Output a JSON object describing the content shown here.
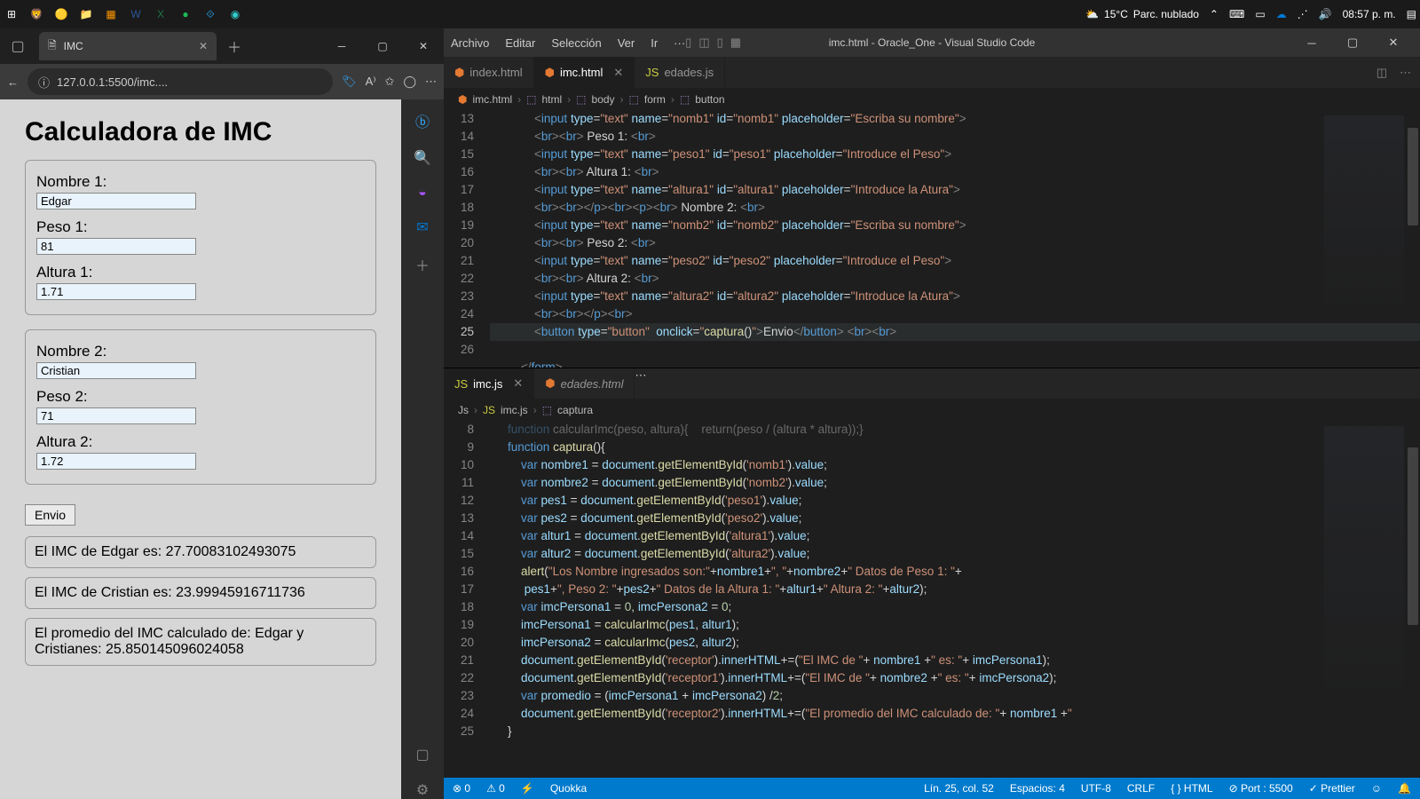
{
  "os_taskbar": {
    "weather_temp": "15°C",
    "weather_desc": "Parc. nublado",
    "time": "08:57 p. m."
  },
  "browser": {
    "tab_title": "IMC",
    "url": "127.0.0.1:5500/imc....",
    "page_title": "Calculadora de IMC",
    "labels": {
      "nombre1": "Nombre 1:",
      "peso1": "Peso 1:",
      "altura1": "Altura 1:",
      "nombre2": "Nombre 2:",
      "peso2": "Peso 2:",
      "altura2": "Altura 2:"
    },
    "values": {
      "nombre1": "Edgar",
      "peso1": "81",
      "altura1": "1.71",
      "nombre2": "Cristian",
      "peso2": "71",
      "altura2": "1.72"
    },
    "envio": "Envio",
    "result1": "El IMC de Edgar es: 27.70083102493075",
    "result2": "El IMC de Cristian es: 23.99945916711736",
    "result3": "El promedio del IMC calculado de: Edgar y Cristianes: 25.850145096024058"
  },
  "vscode": {
    "menu": [
      "Archivo",
      "Editar",
      "Selección",
      "Ver",
      "Ir",
      "···"
    ],
    "title": "imc.html - Oracle_One - Visual Studio Code",
    "tabs_top": [
      {
        "label": "index.html",
        "active": false,
        "type": "html"
      },
      {
        "label": "imc.html",
        "active": true,
        "type": "html",
        "closable": true
      },
      {
        "label": "edades.js",
        "active": false,
        "type": "js"
      }
    ],
    "breadcrumb_top": [
      "imc.html",
      "html",
      "body",
      "form",
      "button"
    ],
    "tabs_bottom": [
      {
        "label": "imc.js",
        "active": true,
        "type": "js",
        "closable": true
      },
      {
        "label": "edades.html",
        "active": false,
        "type": "html",
        "italic": true
      }
    ],
    "breadcrumb_bottom": [
      "Js",
      "imc.js",
      "captura"
    ],
    "status": {
      "errors": "0",
      "warnings": "0",
      "quokka": "Quokka",
      "cursor": "Lín. 25, col. 52",
      "spaces": "Espacios: 4",
      "enc": "UTF-8",
      "eol": "CRLF",
      "lang": "HTML",
      "port": "Port : 5500",
      "prettier": "Prettier"
    }
  }
}
